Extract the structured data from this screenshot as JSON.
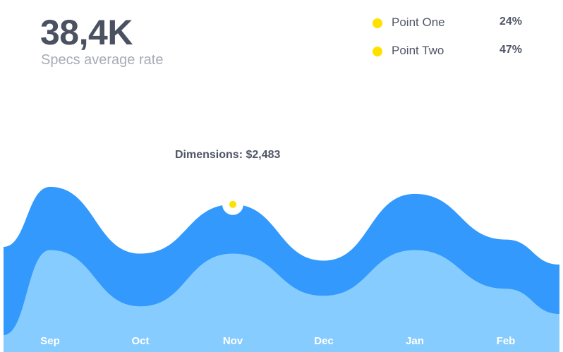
{
  "kpi": {
    "value": "38,4K",
    "label": "Specs average rate"
  },
  "legend": [
    {
      "label": "Point One",
      "value": "24%",
      "color": "#ffe100"
    },
    {
      "label": "Point Two",
      "value": "47%",
      "color": "#ffe100"
    }
  ],
  "tooltip": {
    "text": "Dimensions: $2,483",
    "category": "Nov"
  },
  "colors": {
    "back_area": "#3399fc",
    "front_area": "#87ccfe",
    "marker": "#ffe100"
  },
  "chart_data": {
    "type": "area",
    "categories": [
      "Sep",
      "Oct",
      "Nov",
      "Dec",
      "Jan",
      "Feb"
    ],
    "series": [
      {
        "values": [
          235,
          140,
          210,
          130,
          225,
          160
        ]
      },
      {
        "values": [
          145,
          65,
          140,
          80,
          145,
          90
        ]
      }
    ],
    "ylim": [
      0,
      260
    ]
  }
}
